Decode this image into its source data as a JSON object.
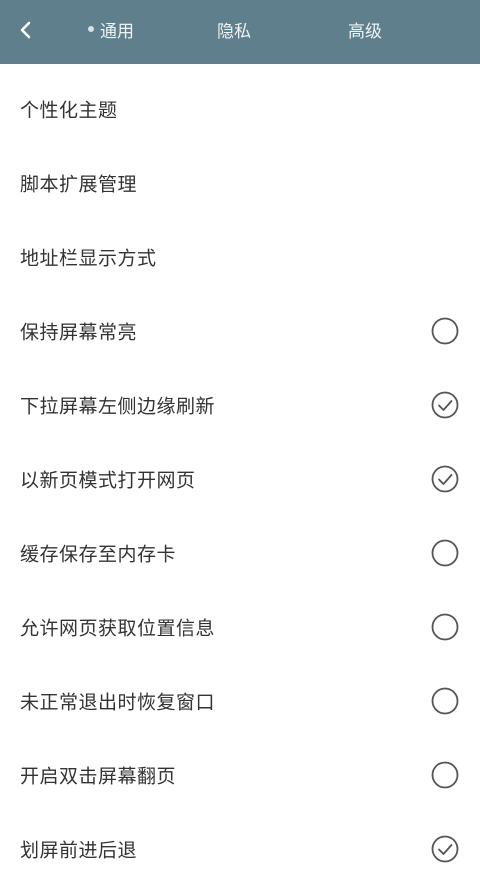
{
  "header": {
    "back_icon": "chevron-left-icon",
    "tabs": [
      {
        "label": "通用",
        "active": true
      },
      {
        "label": "隐私",
        "active": false
      },
      {
        "label": "高级",
        "active": false
      }
    ]
  },
  "colors": {
    "header_bg": "#5f7f8d",
    "text": "#333333",
    "check_stroke": "#555555"
  },
  "settings": [
    {
      "label": "个性化主题"
    },
    {
      "label": "脚本扩展管理"
    },
    {
      "label": "地址栏显示方式"
    },
    {
      "label": "保持屏幕常亮",
      "checked": false
    },
    {
      "label": "下拉屏幕左侧边缘刷新",
      "checked": true
    },
    {
      "label": "以新页模式打开网页",
      "checked": true
    },
    {
      "label": "缓存保存至内存卡",
      "checked": false
    },
    {
      "label": "允许网页获取位置信息",
      "checked": false
    },
    {
      "label": "未正常退出时恢复窗口",
      "checked": false
    },
    {
      "label": "开启双击屏幕翻页",
      "checked": false
    },
    {
      "label": "划屏前进后退",
      "checked": true
    }
  ]
}
